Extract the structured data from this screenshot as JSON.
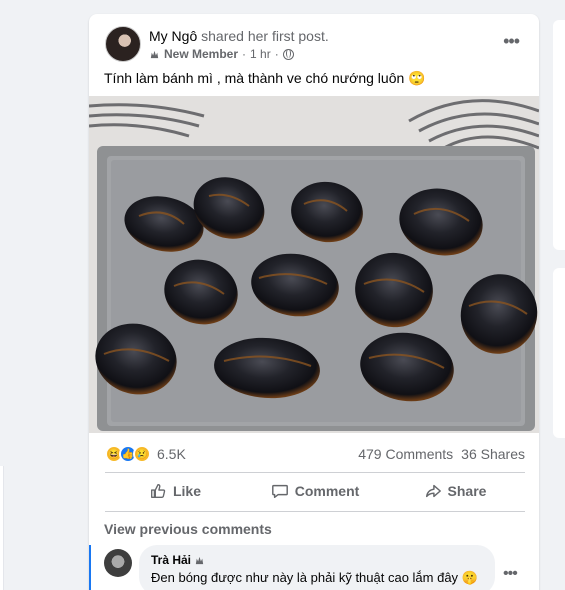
{
  "post": {
    "author": "My Ngô",
    "action_text": " shared her first post.",
    "badge": "New Member",
    "separator": " · ",
    "time": "1 hr",
    "privacy_icon": "globe-icon",
    "text": "Tính làm bánh mì , mà thành ve chó nướng luôn 🙄",
    "image": {
      "subject": "burnt bread rolls on baking tray"
    }
  },
  "reactions": {
    "icons": [
      "haha-reaction-icon",
      "like-reaction-icon",
      "sad-reaction-icon"
    ],
    "count": "6.5K",
    "comments": "479 Comments",
    "shares": "36 Shares"
  },
  "actions": {
    "like": "Like",
    "comment": "Comment",
    "share": "Share"
  },
  "comments": {
    "view_previous": "View previous comments",
    "items": [
      {
        "name": "Trà Hải",
        "text": "Đen bóng được như này là phải kỹ thuật cao lắm đây 🤫"
      }
    ]
  },
  "colors": {
    "accent": "#1877f2",
    "secondary_text": "#65676b",
    "background": "#f0f2f5"
  }
}
